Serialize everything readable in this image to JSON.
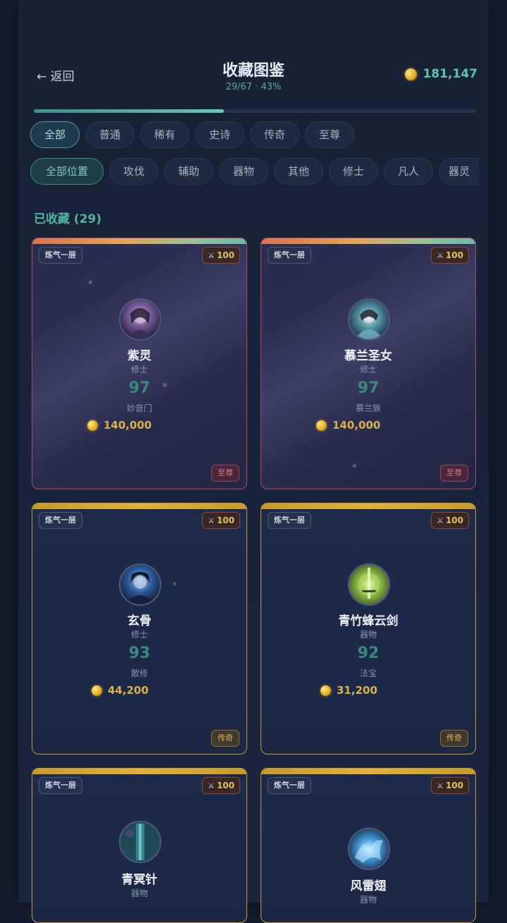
{
  "header": {
    "back_label": "← 返回",
    "title": "收藏图鉴",
    "progress_text": "29/67 · 43%",
    "progress_fraction": 0.43,
    "coins": "181,147"
  },
  "filters": {
    "rarity": [
      "全部",
      "普通",
      "稀有",
      "史诗",
      "传奇",
      "至尊"
    ],
    "rarity_active": "全部",
    "position": [
      "全部位置",
      "攻伐",
      "辅助",
      "器物",
      "其他",
      "修士",
      "凡人",
      "器灵"
    ],
    "position_active": "全部位置"
  },
  "section": {
    "heading": "已收藏 (29)"
  },
  "cards": [
    {
      "realm": "炼气一层",
      "power": "100",
      "name": "紫灵",
      "role": "修士",
      "score": "97",
      "origin": "妙音门",
      "price": "140,000",
      "rarity": "至尊",
      "tier": "supreme",
      "accent": "#7a5a9a"
    },
    {
      "realm": "炼气一层",
      "power": "100",
      "name": "慕兰圣女",
      "role": "修士",
      "score": "97",
      "origin": "慕兰族",
      "price": "140,000",
      "rarity": "至尊",
      "tier": "supreme",
      "accent": "#4a8a9a"
    },
    {
      "realm": "炼气一层",
      "power": "100",
      "name": "玄骨",
      "role": "修士",
      "score": "93",
      "origin": "散修",
      "price": "44,200",
      "rarity": "传奇",
      "tier": "legendary",
      "accent": "#2a5a9a"
    },
    {
      "realm": "炼气一层",
      "power": "100",
      "name": "青竹蜂云剑",
      "role": "器物",
      "score": "92",
      "origin": "法宝",
      "price": "31,200",
      "rarity": "传奇",
      "tier": "legendary",
      "accent": "#9ac84a"
    },
    {
      "realm": "炼气一层",
      "power": "100",
      "name": "青冥针",
      "role": "器物",
      "score": "",
      "origin": "",
      "price": "",
      "rarity": "",
      "tier": "legendary",
      "accent": "#3aa0a8"
    },
    {
      "realm": "炼气一层",
      "power": "100",
      "name": "风雷翅",
      "role": "器物",
      "score": "",
      "origin": "",
      "price": "",
      "rarity": "",
      "tier": "legendary",
      "accent": "#4aa0e0"
    }
  ],
  "colors": {
    "accent_teal": "#4fb39f",
    "gold": "#d9b04a",
    "supreme_red": "#b34a5a",
    "legendary_gold": "#c69a2c"
  }
}
